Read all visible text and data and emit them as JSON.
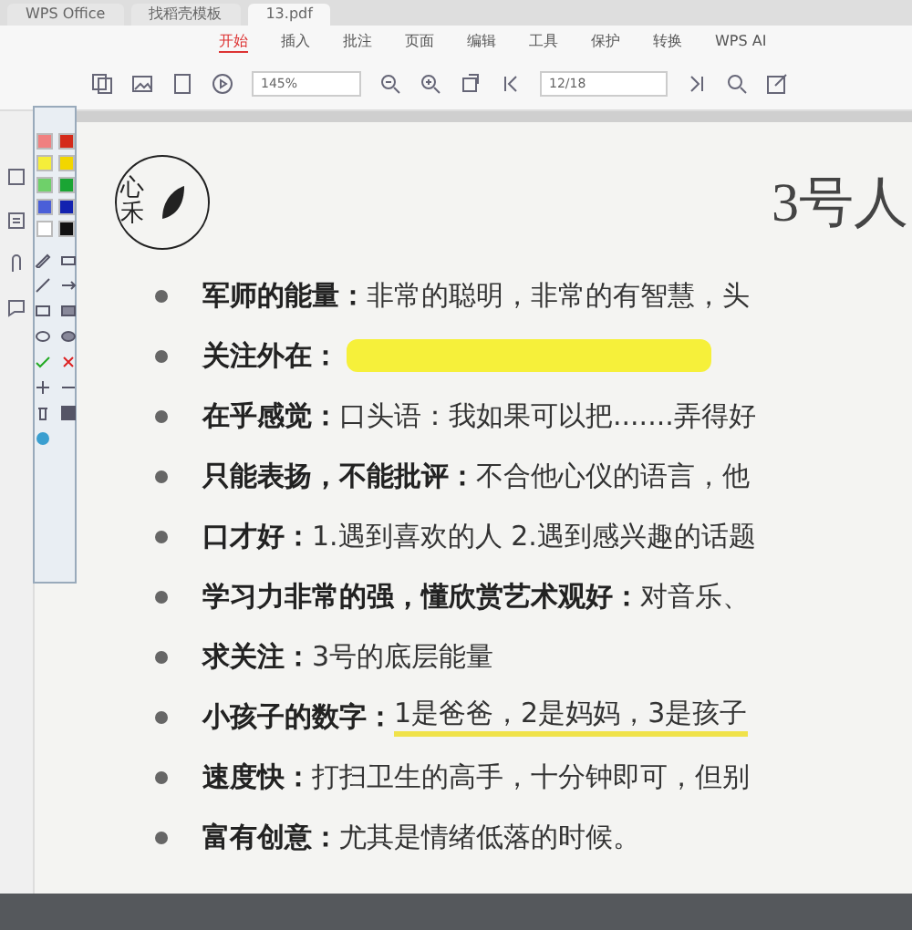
{
  "tabs": [
    {
      "label": "WPS Office",
      "selected": false
    },
    {
      "label": "找稻壳模板",
      "selected": false
    },
    {
      "label": "13.pdf",
      "selected": true
    }
  ],
  "menu": [
    {
      "label": "开始",
      "selected": true
    },
    {
      "label": "插入",
      "selected": false
    },
    {
      "label": "批注",
      "selected": false
    },
    {
      "label": "页面",
      "selected": false
    },
    {
      "label": "编辑",
      "selected": false
    },
    {
      "label": "工具",
      "selected": false
    },
    {
      "label": "保护",
      "selected": false
    },
    {
      "label": "转换",
      "selected": false
    },
    {
      "label": "WPS AI",
      "selected": false
    }
  ],
  "toolbar": {
    "zoom": "145%",
    "page": "12/18"
  },
  "palette": {
    "swatches": [
      {
        "color": "#f08080"
      },
      {
        "color": "#d42a1a"
      },
      {
        "color": "#f5ee3a"
      },
      {
        "color": "#f2d600"
      },
      {
        "color": "#6fd06a"
      },
      {
        "color": "#1aa534"
      },
      {
        "color": "#4a5fd8"
      },
      {
        "color": "#1222b0"
      },
      {
        "color": "#ffffff"
      },
      {
        "color": "#111111"
      }
    ]
  },
  "document": {
    "logo": "心禾",
    "title": "3号人",
    "items": [
      {
        "kind": "plain",
        "label": "军师的能量：",
        "text": "非常的聪明，非常的有智慧，头"
      },
      {
        "kind": "covered",
        "label": "关注外在："
      },
      {
        "kind": "plain",
        "label": "在乎感觉：",
        "text": "口头语：我如果可以把.......弄得好"
      },
      {
        "kind": "plain",
        "label": "只能表扬，不能批评：",
        "text": "不合他心仪的语言，他"
      },
      {
        "kind": "plain",
        "label": "口才好：",
        "text": "1.遇到喜欢的人 2.遇到感兴趣的话题"
      },
      {
        "kind": "plain",
        "label": "学习力非常的强，懂欣赏艺术观好：",
        "text": "对音乐、"
      },
      {
        "kind": "plain",
        "label": "求关注：",
        "text": "3号的底层能量"
      },
      {
        "kind": "underlined",
        "label": "小孩子的数字：",
        "text": "1是爸爸，2是妈妈，3是孩子"
      },
      {
        "kind": "plain",
        "label": "速度快：",
        "text": "打扫卫生的高手，十分钟即可，但别"
      },
      {
        "kind": "plain",
        "label": "富有创意：",
        "text": "尤其是情绪低落的时候。"
      }
    ]
  }
}
